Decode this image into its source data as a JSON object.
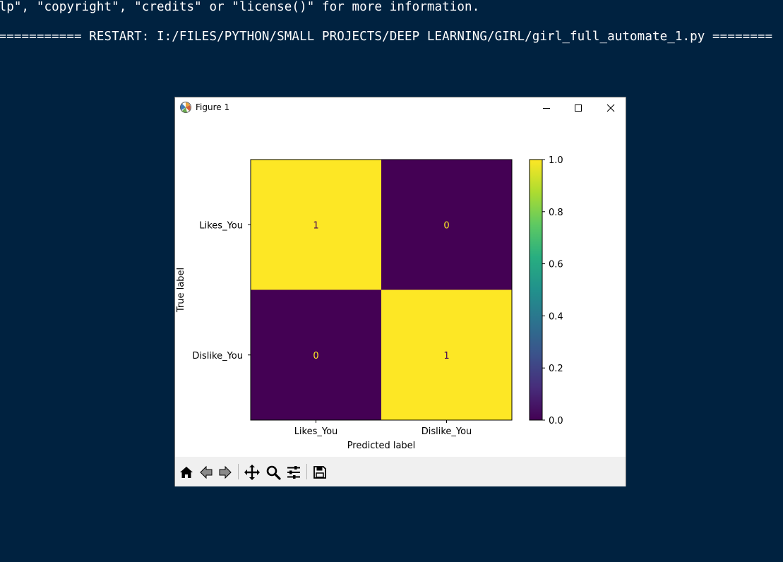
{
  "shell": {
    "line1": "elp\", \"copyright\", \"credits\" or \"license()\" for more information.",
    "line2": "============ RESTART: I:/FILES/PYTHON/SMALL PROJECTS/DEEP LEARNING/GIRL/girl_full_automate_1.py ========"
  },
  "window": {
    "title": "Figure 1",
    "icons": [
      "matplotlib-logo-icon",
      "minimize-icon",
      "maximize-icon",
      "close-icon"
    ]
  },
  "toolbar": {
    "icons": [
      "home-icon",
      "back-arrow-icon",
      "forward-arrow-icon",
      "pan-icon",
      "zoom-icon",
      "configure-subplots-icon",
      "save-icon"
    ]
  },
  "chart_data": {
    "type": "heatmap",
    "xlabel": "Predicted label",
    "ylabel": "True label",
    "x_categories": [
      "Likes_You",
      "Dislike_You"
    ],
    "y_categories": [
      "Likes_You",
      "Dislike_You"
    ],
    "values": [
      [
        1,
        0
      ],
      [
        0,
        1
      ]
    ],
    "colormap": "viridis",
    "colors": {
      "high": "#fde725",
      "low": "#440154",
      "cell_text_on_low": "#fde725",
      "cell_text_on_high": "#440154"
    },
    "colorbar": {
      "range": [
        0.0,
        1.0
      ],
      "ticks": [
        "0.0",
        "0.2",
        "0.4",
        "0.6",
        "0.8",
        "1.0"
      ]
    }
  }
}
